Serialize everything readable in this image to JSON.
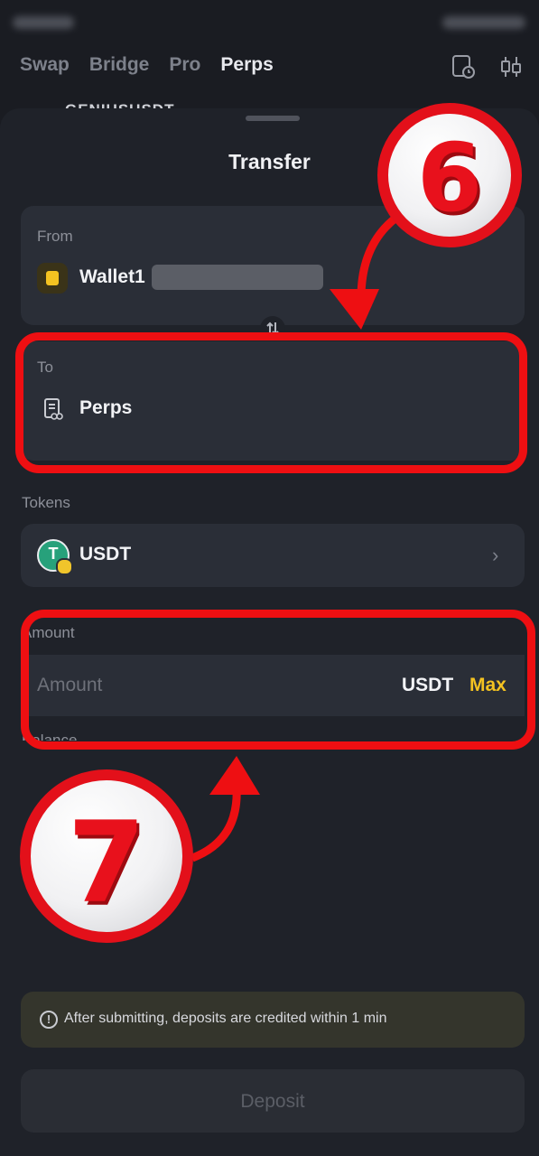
{
  "topnav": {
    "tabs": [
      "Swap",
      "Bridge",
      "Pro",
      "Perps"
    ],
    "active": "Perps",
    "icons": [
      "history-icon",
      "chart-icon"
    ]
  },
  "peek_pair": "GENIUSUSDT",
  "sheet": {
    "title": "Transfer",
    "from": {
      "label": "From",
      "value": "Wallet1"
    },
    "to": {
      "label": "To",
      "value": "Perps"
    },
    "tokens": {
      "label": "Tokens",
      "value": "USDT"
    },
    "amount": {
      "label": "Amount",
      "placeholder": "Amount",
      "unit": "USDT",
      "max": "Max"
    },
    "balance_label": "Balance",
    "notice": "After submitting, deposits are credited within 1 min",
    "deposit_button": "Deposit"
  },
  "annotations": {
    "step_a": "6",
    "step_b": "7"
  },
  "colors": {
    "background": "#1f2229",
    "card": "#2a2e37",
    "accent_yellow": "#f3c221",
    "highlight_red": "#ee0f12",
    "usdt_green": "#27a17b"
  }
}
